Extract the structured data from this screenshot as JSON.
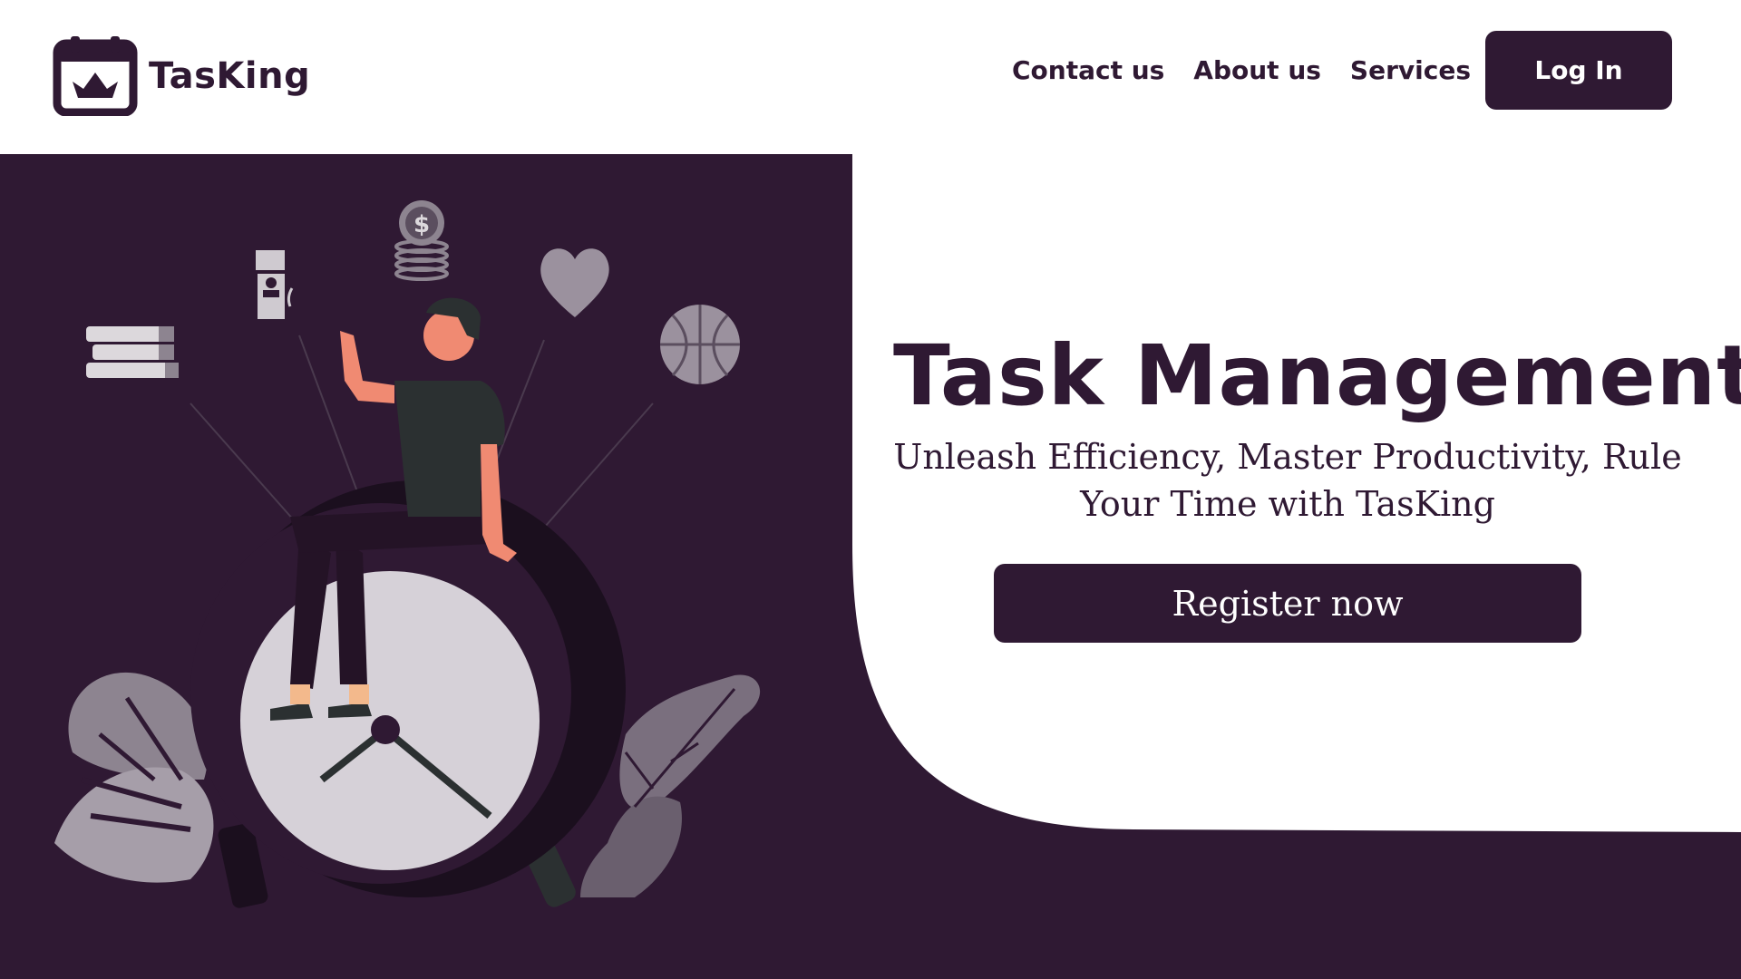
{
  "brand": {
    "name": "TasKing",
    "logo_icon": "crown-calendar-icon"
  },
  "nav": {
    "links": [
      "Contact us",
      "About us",
      "Services"
    ],
    "login_label": "Log In"
  },
  "hero": {
    "title": "Task Management",
    "subtitle": "Unleash Efficiency, Master Productivity, Rule Your Time with TasKing",
    "cta_label": "Register now"
  },
  "colors": {
    "primary": "#2f1933",
    "background": "#ffffff",
    "clock_face": "#d6d1d8"
  }
}
